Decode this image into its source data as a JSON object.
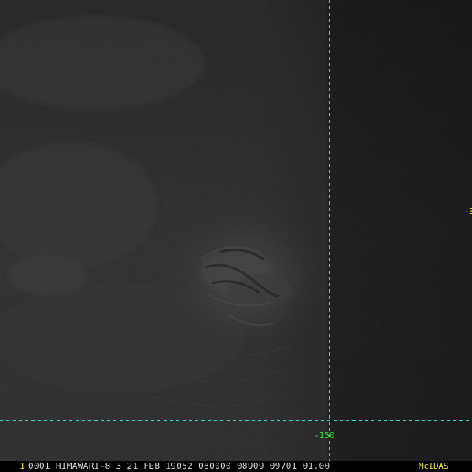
{
  "overlay": {
    "longitude_label": "-150",
    "edge_label": "-3"
  },
  "status_bar": {
    "frame_number": "1",
    "info_text": "0001 HIMAWARI-8   3 21 FEB 19052 080000 08909 09701 01.00",
    "brand": "McIDAS"
  },
  "colors": {
    "grid_line": "#2fd6cc",
    "longitude_label": "#35e035",
    "status_text": "#d8d8d8",
    "frame_number": "#f0e030",
    "brand": "#f0e030",
    "edge_label": "#f0e030"
  }
}
